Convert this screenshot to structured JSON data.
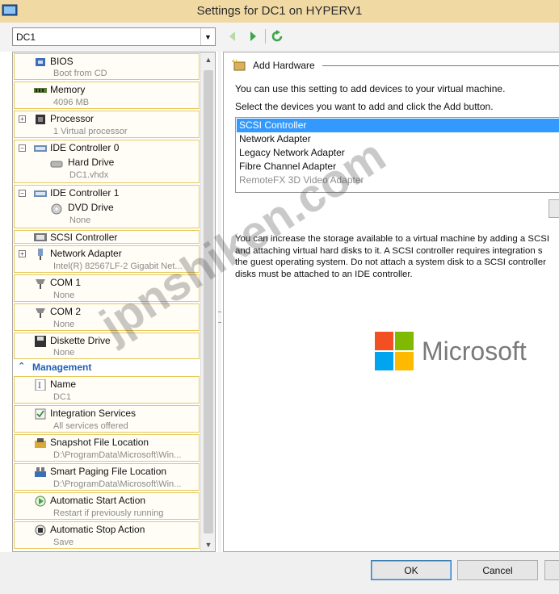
{
  "window": {
    "title": "Settings for DC1 on HYPERV1"
  },
  "toolbar": {
    "vm_selected": "DC1"
  },
  "hardware": [
    {
      "label": "BIOS",
      "sub": "Boot from CD",
      "icon": "bios-icon"
    },
    {
      "label": "Memory",
      "sub": "4096 MB",
      "icon": "memory-icon"
    },
    {
      "label": "Processor",
      "sub": "1 Virtual processor",
      "icon": "processor-icon"
    },
    {
      "label": "IDE Controller 0",
      "child_label": "Hard Drive",
      "child_sub": "DC1.vhdx",
      "icon": "ide-controller-icon"
    },
    {
      "label": "IDE Controller 1",
      "child_label": "DVD Drive",
      "child_sub": "None",
      "icon": "ide-controller-icon"
    },
    {
      "label": "SCSI Controller",
      "icon": "scsi-icon"
    },
    {
      "label": "Network Adapter",
      "sub": "Intel(R) 82567LF-2 Gigabit Net...",
      "icon": "network-adapter-icon"
    },
    {
      "label": "COM 1",
      "sub": "None",
      "icon": "com-port-icon"
    },
    {
      "label": "COM 2",
      "sub": "None",
      "icon": "com-port-icon"
    },
    {
      "label": "Diskette Drive",
      "sub": "None",
      "icon": "diskette-icon"
    }
  ],
  "management": {
    "header": "Management",
    "items": [
      {
        "label": "Name",
        "sub": "DC1",
        "icon": "name-icon"
      },
      {
        "label": "Integration Services",
        "sub": "All services offered",
        "icon": "integration-services-icon"
      },
      {
        "label": "Snapshot File Location",
        "sub": "D:\\ProgramData\\Microsoft\\Win...",
        "icon": "snapshot-icon"
      },
      {
        "label": "Smart Paging File Location",
        "sub": "D:\\ProgramData\\Microsoft\\Win...",
        "icon": "smart-paging-icon"
      },
      {
        "label": "Automatic Start Action",
        "sub": "Restart if previously running",
        "icon": "auto-start-icon"
      },
      {
        "label": "Automatic Stop Action",
        "sub": "Save",
        "icon": "auto-stop-icon"
      }
    ]
  },
  "content": {
    "section_title": "Add Hardware",
    "intro": "You can use this setting to add devices to your virtual machine.",
    "instruction": "Select the devices you want to add and click the Add button.",
    "devices": [
      {
        "label": "SCSI Controller",
        "state": "selected"
      },
      {
        "label": "Network Adapter",
        "state": "normal"
      },
      {
        "label": "Legacy Network Adapter",
        "state": "normal"
      },
      {
        "label": "Fibre Channel Adapter",
        "state": "normal"
      },
      {
        "label": "RemoteFX 3D Video Adapter",
        "state": "disabled"
      }
    ],
    "description_lines": [
      "You can increase the storage available to a virtual machine by adding a SCSI",
      "and attaching virtual hard disks to it. A SCSI controller requires integration s",
      "the guest operating system. Do not attach a system disk to a SCSI controller",
      "disks must be attached to an IDE controller."
    ]
  },
  "branding": {
    "logo_text": "Microsoft",
    "logo_colors": [
      "#f25022",
      "#7fba00",
      "#00a4ef",
      "#ffb900"
    ],
    "watermark": "jpnshiken.com"
  },
  "buttons": {
    "ok": "OK",
    "cancel": "Cancel"
  },
  "colors": {
    "accent": "#1f5fb5",
    "selection": "#3399ff",
    "tree_border": "#e6c85c"
  }
}
